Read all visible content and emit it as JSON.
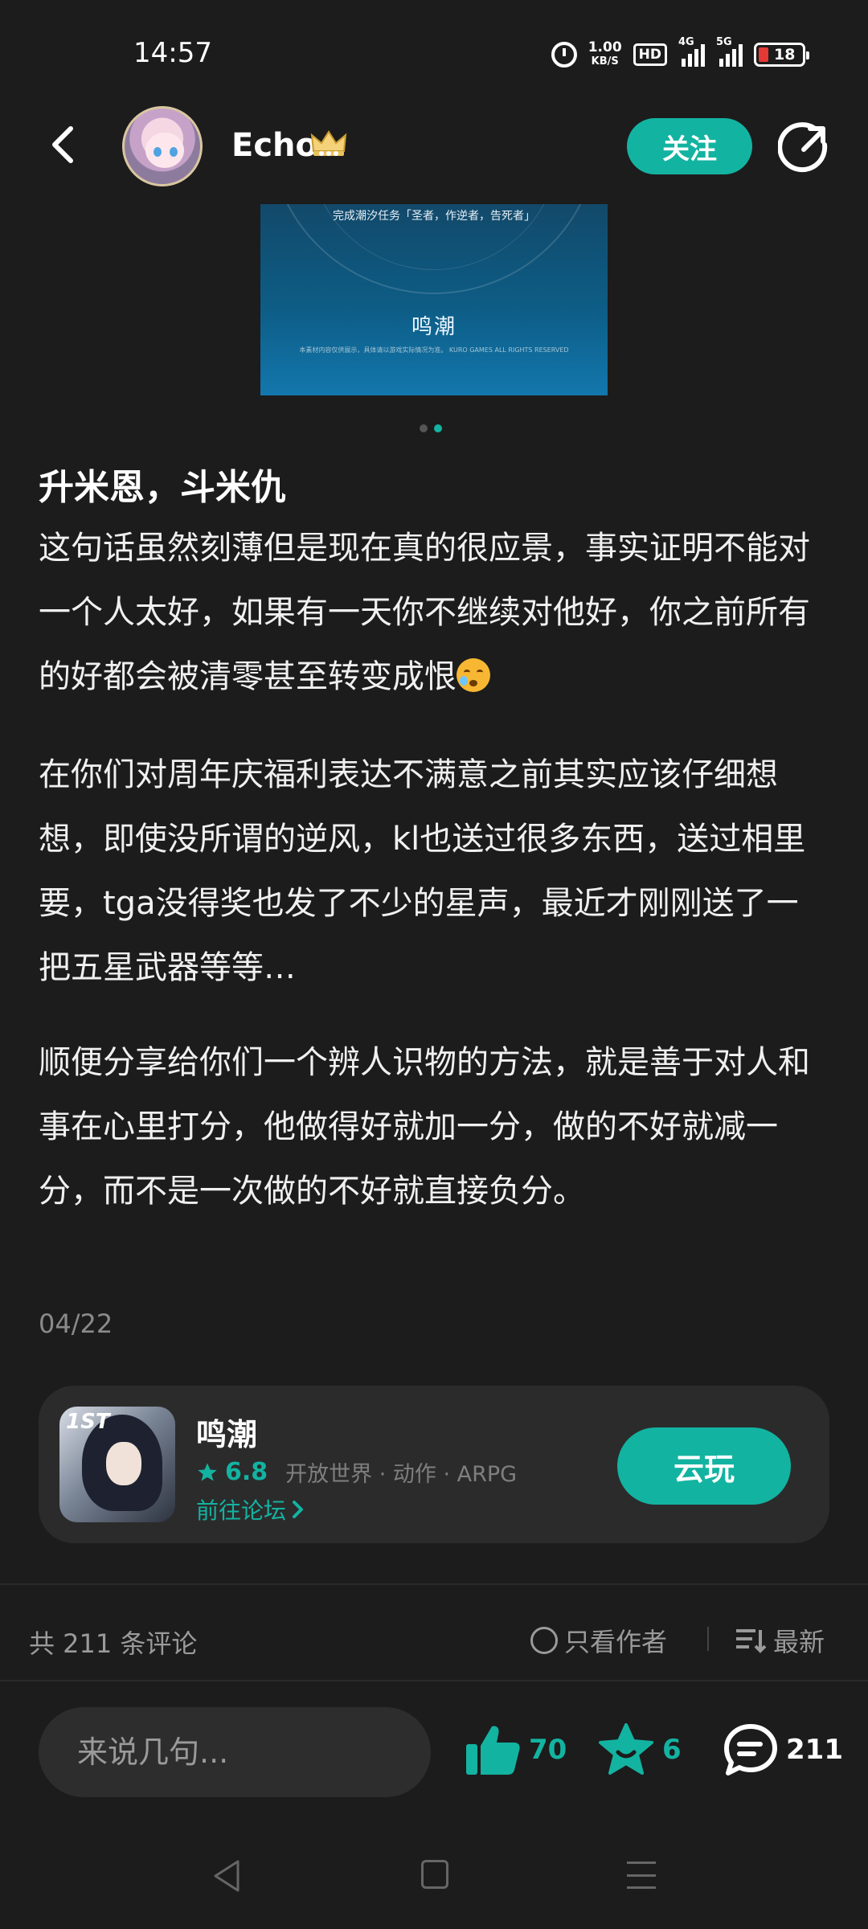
{
  "status_bar": {
    "time": "14:57",
    "net_speed": "1.00",
    "net_speed_unit": "KB/S",
    "hd": "HD",
    "net_4g": "4G",
    "net_5g": "5G",
    "battery": "18",
    "battery_color": "#e53935"
  },
  "header": {
    "username": "Echo",
    "follow_label": "关注",
    "back_icon": "chevron-left-icon",
    "share_icon": "share-icon"
  },
  "image": {
    "caption": "完成潮汐任务「圣者，作逆者，告死者」",
    "logo": "鸣潮",
    "fine_print": "本素材内容仅供展示，具体请以游戏实际情况为准。 KURO GAMES ALL RIGHTS RESERVED",
    "page_index": 2,
    "page_count": 2
  },
  "post": {
    "title": "升米恩，斗米仇",
    "paragraph1": "这句话虽然刻薄但是现在真的很应景，事实证明不能对一个人太好，如果有一天你不继续对他好，你之前所有的好都会被清零甚至转变成恨",
    "paragraph2": "在你们对周年庆福利表达不满意之前其实应该仔细想想，即使没所谓的逆风，kl也送过很多东西，送过相里要，tga没得奖也发了不少的星声，最近才刚刚送了一把五星武器等等…",
    "paragraph3": "顺便分享给你们一个辨人识物的方法，就是善于对人和事在心里打分，他做得好就加一分，做的不好就减一分，而不是一次做的不好就直接负分。",
    "date": "04/22"
  },
  "game_card": {
    "icon_badge": "1ST",
    "name": "鸣潮",
    "rating": "6.8",
    "tags": "开放世界 · 动作 · ARPG",
    "forum_link": "前往论坛",
    "play_label": "云玩",
    "accent_color": "#13b3a1"
  },
  "comments_bar": {
    "count_label": "共 211 条评论",
    "author_only_label": "只看作者",
    "sort_label": "最新"
  },
  "bottom_bar": {
    "input_placeholder": "来说几句...",
    "likes": "70",
    "favorites": "6",
    "comments": "211"
  }
}
